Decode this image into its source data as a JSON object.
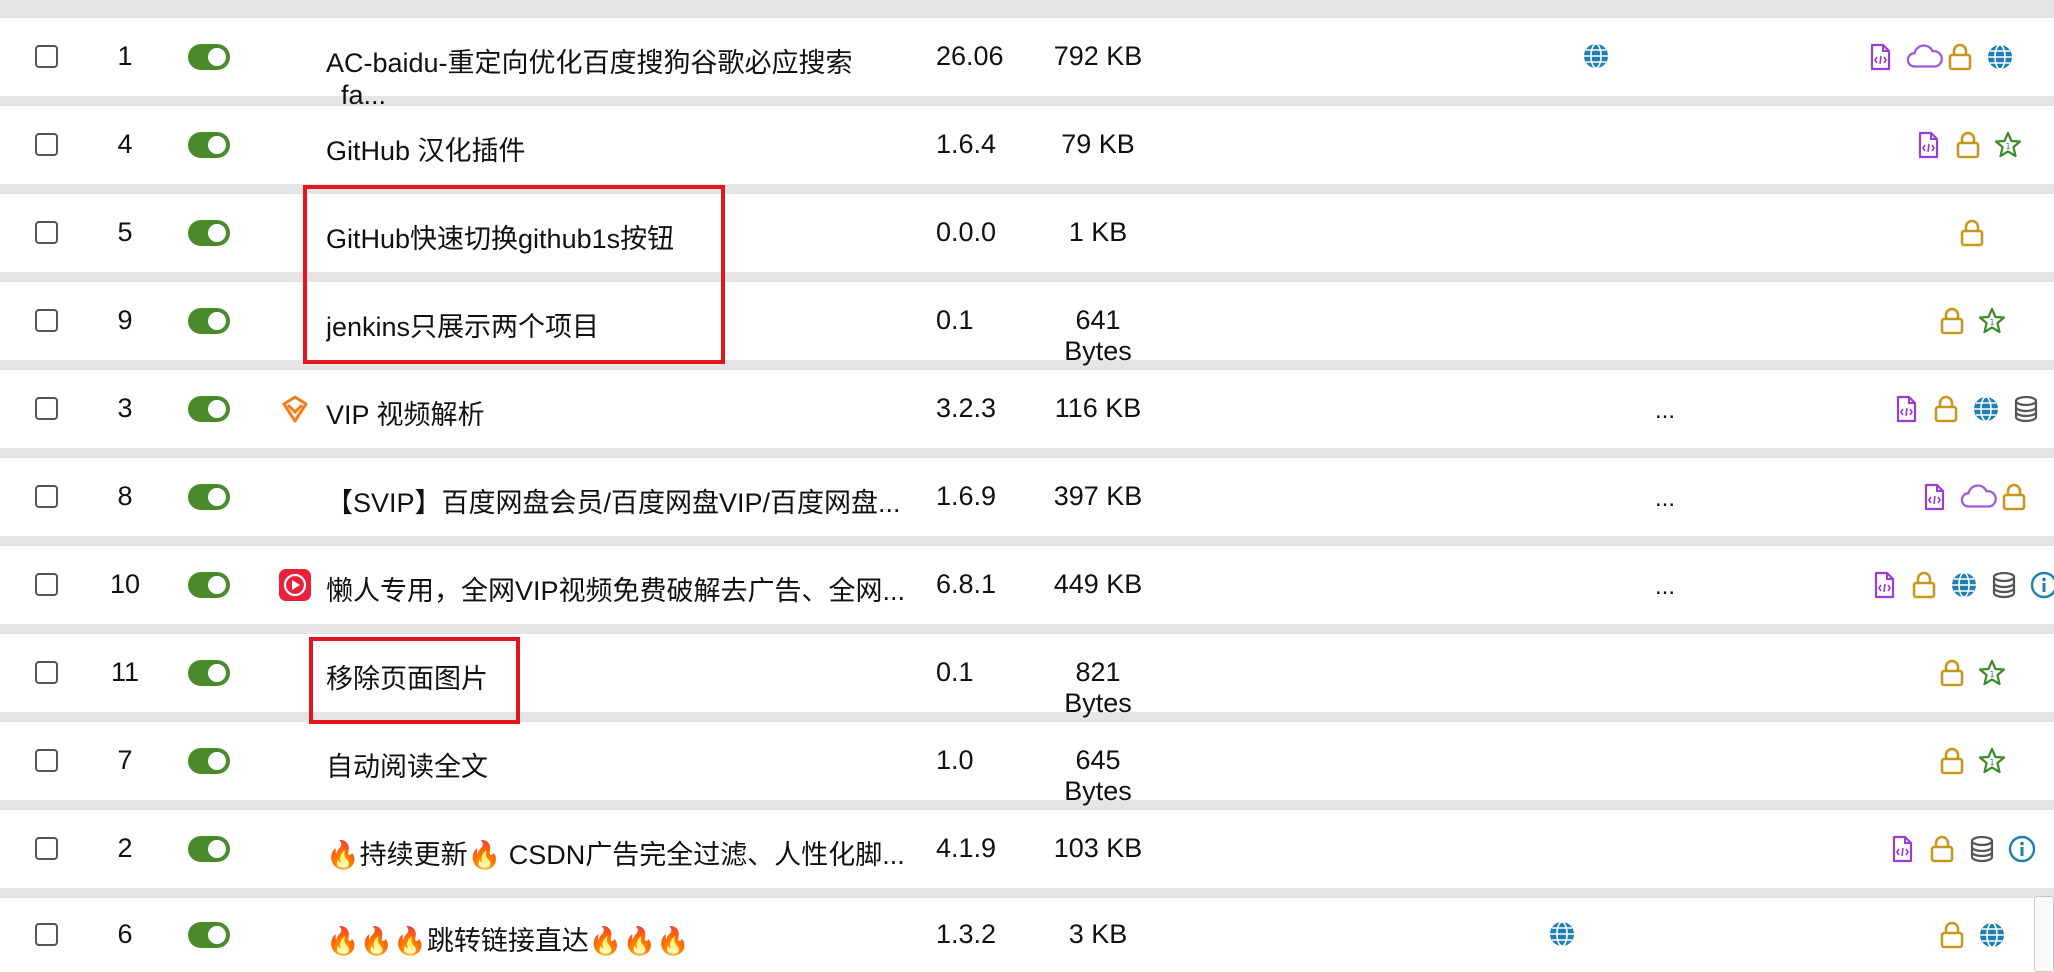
{
  "rows": [
    {
      "id": "1",
      "name": "AC-baidu-重定向优化百度搜狗谷歌必应搜索_fa...",
      "version": "26.06",
      "size": "792 KB",
      "homepage_icon": "globe-icon",
      "dots": "",
      "source_icon": "",
      "action_icons": [
        "code-file-icon",
        "cloud-icon",
        "lock-icon",
        "globe-icon"
      ]
    },
    {
      "id": "4",
      "name": "GitHub 汉化插件",
      "version": "1.6.4",
      "size": "79 KB",
      "homepage_icon": "",
      "dots": "",
      "source_icon": "",
      "action_icons": [
        "code-file-icon",
        "lock-icon",
        "star-icon"
      ]
    },
    {
      "id": "5",
      "name": "GitHub快速切换github1s按钮",
      "version": "0.0.0",
      "size": "1 KB",
      "homepage_icon": "",
      "dots": "",
      "source_icon": "",
      "action_icons": [
        "lock-icon"
      ]
    },
    {
      "id": "9",
      "name": "jenkins只展示两个项目",
      "version": "0.1",
      "size": "641 Bytes",
      "homepage_icon": "",
      "dots": "",
      "source_icon": "",
      "action_icons": [
        "lock-icon",
        "star-icon"
      ]
    },
    {
      "id": "3",
      "name": "VIP 视频解析",
      "version": "3.2.3",
      "size": "116 KB",
      "homepage_icon": "",
      "dots": "...",
      "source_icon": "vip-diamond-icon",
      "action_icons": [
        "code-file-icon",
        "lock-icon",
        "globe-icon",
        "database-icon"
      ]
    },
    {
      "id": "8",
      "name": "【SVIP】百度网盘会员/百度网盘VIP/百度网盘...",
      "version": "1.6.9",
      "size": "397 KB",
      "homepage_icon": "",
      "dots": "...",
      "source_icon": "",
      "action_icons": [
        "code-file-icon",
        "cloud-icon",
        "lock-icon"
      ]
    },
    {
      "id": "10",
      "name": "懒人专用，全网VIP视频免费破解去广告、全网...",
      "version": "6.8.1",
      "size": "449 KB",
      "homepage_icon": "",
      "dots": "...",
      "source_icon": "video-play-icon",
      "action_icons": [
        "code-file-icon",
        "lock-icon",
        "globe-icon",
        "database-icon",
        "info-icon"
      ]
    },
    {
      "id": "11",
      "name": "移除页面图片",
      "version": "0.1",
      "size": "821 Bytes",
      "homepage_icon": "",
      "dots": "",
      "source_icon": "",
      "action_icons": [
        "lock-icon",
        "star-icon"
      ]
    },
    {
      "id": "7",
      "name": "自动阅读全文",
      "version": "1.0",
      "size": "645 Bytes",
      "homepage_icon": "",
      "dots": "",
      "source_icon": "",
      "action_icons": [
        "lock-icon",
        "star-icon"
      ]
    },
    {
      "id": "2",
      "name": "🔥持续更新🔥 CSDN广告完全过滤、人性化脚...",
      "version": "4.1.9",
      "size": "103 KB",
      "homepage_icon": "",
      "dots": "",
      "source_icon": "",
      "action_icons": [
        "code-file-icon",
        "lock-icon",
        "database-icon",
        "info-icon"
      ]
    },
    {
      "id": "6",
      "name": "🔥🔥🔥跳转链接直达🔥🔥🔥",
      "version": "1.3.2",
      "size": "3 KB",
      "homepage_icon": "globe-icon",
      "dots": "",
      "source_icon": "",
      "action_icons": [
        "lock-icon",
        "globe-icon"
      ]
    }
  ],
  "colors": {
    "toggle_on": "#4b8a2a",
    "code_file": "#9a3cd6",
    "cloud": "#9a5bd9",
    "lock": "#c8961a",
    "star": "#3e8a2a",
    "globe": "#1f7fb0",
    "database": "#555555",
    "info": "#1f7fb0",
    "highlight": "#e3161d",
    "vip": "#f27c1e",
    "video": "#e8223a"
  }
}
